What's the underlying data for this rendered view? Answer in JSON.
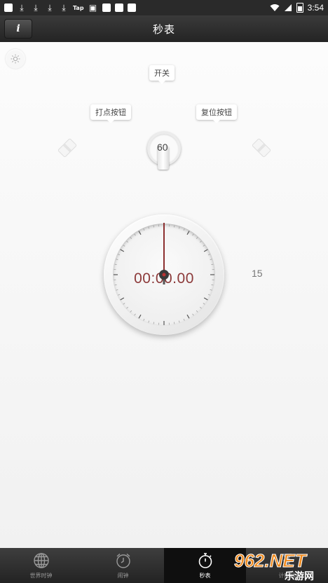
{
  "status_bar": {
    "time": "3:54",
    "tap_label": "Tap"
  },
  "header": {
    "info_label": "i",
    "title": "秒表"
  },
  "stopwatch": {
    "callouts": {
      "switch": "开关",
      "lap_button": "打点按钮",
      "reset_button": "复位按钮"
    },
    "minute_dial_value": "60",
    "side_label": "15",
    "time_display": "00:00.00"
  },
  "bottom_nav": {
    "tabs": [
      {
        "label": "世界时钟",
        "icon": "globe-icon"
      },
      {
        "label": "闹钟",
        "icon": "alarm-clock-icon"
      },
      {
        "label": "秒表",
        "icon": "stopwatch-icon",
        "active": true
      },
      {
        "label": "计时器",
        "icon": "timer-icon"
      }
    ]
  },
  "watermark": {
    "text": "962.NET",
    "subtext": "乐游网"
  },
  "colors": {
    "accent_red": "#8c3a3a",
    "bar_dark": "#242424"
  }
}
